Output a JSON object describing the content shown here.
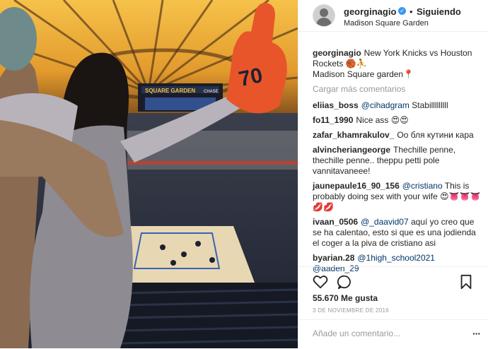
{
  "post": {
    "header": {
      "username": "georginagio",
      "follow_label": "Siguiendo",
      "separator": "•",
      "location": "Madison Square Garden"
    },
    "caption": {
      "username": "georginagio",
      "line1": "New York Knicks vs Houston Rockets 🏀⛹",
      "line2": "Madison Square garden📍"
    },
    "load_more": "Cargar más comentarios",
    "comments": [
      {
        "user": "eliias_boss",
        "mention": "@cihadgram",
        "text": " Stabilllllllll"
      },
      {
        "user": "fo11_1990",
        "mention": "",
        "text": "Nice ass 😍😍"
      },
      {
        "user": "zafar_khamrakulov_",
        "mention": "",
        "text": "Оо бля кутини кара"
      },
      {
        "user": "alvincheriangeorge",
        "mention": "",
        "text": "Thechille penne, thechille penne.. theppu petti pole vannitavaneee!"
      },
      {
        "user": "jaunepaule16_90_156",
        "mention": "@cristiano",
        "text": " This is probably doing sex with your wife 😍👅👅👅💋💋"
      },
      {
        "user": "ivaan_0506",
        "mention": "@_daavid07",
        "text": " aquí yo creo que se ha calentao, esto si que es una jodienda el coger a la piva de cristiano asi"
      },
      {
        "user": "byarian.28",
        "mention": "@1high_school2021 @aaden_29",
        "text": ""
      }
    ],
    "likes": "55.670 Me gusta",
    "date": "3 DE NOVIEMBRE DE 2016",
    "add_comment_placeholder": "Añade un comentario...",
    "icons": {
      "like": "heart-icon",
      "comment": "comment-icon",
      "save": "bookmark-icon",
      "options": "more-options-icon"
    },
    "photo_text": {
      "arena_sign": "SQUARE GARDEN",
      "sign_side": "CHASE",
      "foam_finger": "70"
    },
    "colors": {
      "link": "#003569",
      "muted": "#999999",
      "verified": "#3897f0",
      "text": "#262626"
    }
  }
}
